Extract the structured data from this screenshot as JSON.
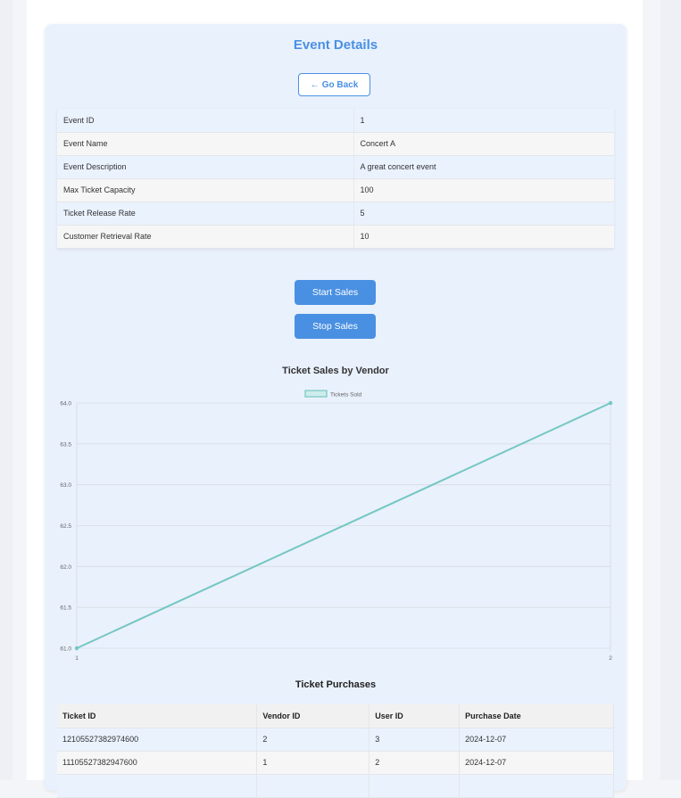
{
  "page_title": "Event Details",
  "back_button": {
    "arrow": "←",
    "label": "Go Back"
  },
  "event_details": [
    {
      "label": "Event ID",
      "value": "1"
    },
    {
      "label": "Event Name",
      "value": "Concert A"
    },
    {
      "label": "Event Description",
      "value": "A great concert event"
    },
    {
      "label": "Max Ticket Capacity",
      "value": "100"
    },
    {
      "label": "Ticket Release Rate",
      "value": "5"
    },
    {
      "label": "Customer Retrieval Rate",
      "value": "10"
    }
  ],
  "actions": {
    "start_label": "Start Sales",
    "stop_label": "Stop Sales"
  },
  "colors": {
    "accent": "#4a90e2",
    "line": "#75c7c2",
    "card_bg": "#e9f1fd"
  },
  "chart_data": {
    "type": "line",
    "title": "Ticket Sales by Vendor",
    "x": [
      "1",
      "2"
    ],
    "series": [
      {
        "name": "Tickets Sold",
        "values": [
          61.0,
          64.0
        ]
      }
    ],
    "ylim": [
      61.0,
      64.0
    ],
    "yticks": [
      "64.0",
      "63.5",
      "63.0",
      "62.5",
      "62.0",
      "61.5",
      "61.0"
    ],
    "grid": true,
    "legend": "top-center"
  },
  "purchases": {
    "title": "Ticket Purchases",
    "columns": [
      "Ticket ID",
      "Vendor ID",
      "User ID",
      "Purchase Date"
    ],
    "rows": [
      [
        "12105527382974600",
        "2",
        "3",
        "2024-12-07"
      ],
      [
        "11105527382947600",
        "1",
        "2",
        "2024-12-07"
      ],
      [
        "",
        "",
        "",
        ""
      ]
    ]
  }
}
